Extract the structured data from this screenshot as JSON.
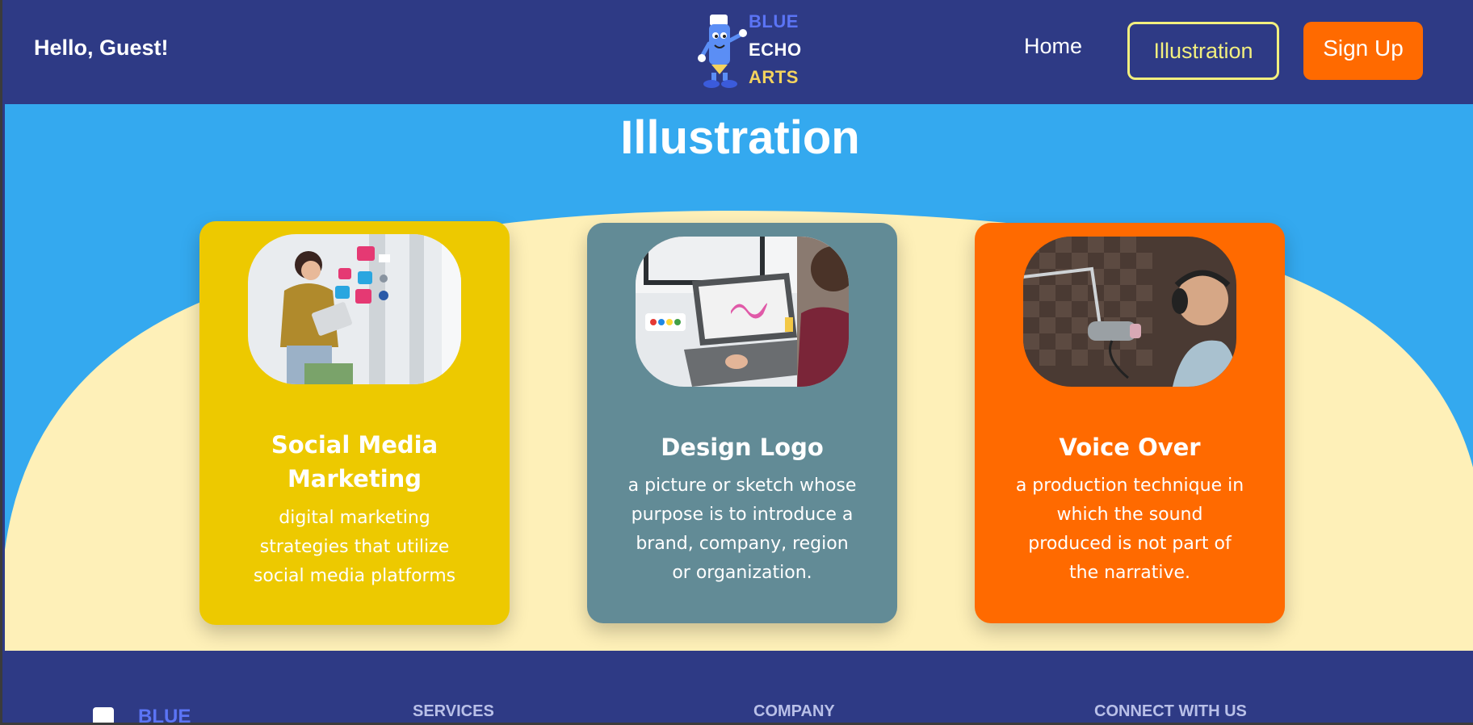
{
  "header": {
    "greeting": "Hello, Guest!",
    "logo_words": [
      "BLUE",
      "ECHO",
      "ARTS"
    ],
    "nav": {
      "home": "Home",
      "illustration": "Illustration",
      "sign_up": "Sign Up"
    }
  },
  "hero": {
    "title": "Illustration"
  },
  "cards": [
    {
      "title": "Social Media Marketing",
      "description": "digital marketing strategies that utilize social media platforms",
      "image_icon": "social-media-photo"
    },
    {
      "title": "Design Logo",
      "description": "a picture or sketch whose purpose is to introduce a brand, company, region or organization.",
      "image_icon": "logo-design-photo"
    },
    {
      "title": "Voice Over",
      "description": "a production technique in which the sound produced is not part of the narrative.",
      "image_icon": "voice-over-photo"
    }
  ],
  "footer": {
    "brand": "BLUE",
    "columns": [
      "SERVICES",
      "COMPANY",
      "CONNECT WITH US"
    ]
  },
  "colors": {
    "navy": "#2e3a85",
    "sky": "#34a9ef",
    "cream": "#fef0b8",
    "yellow": "#edc900",
    "teal": "#628b96",
    "orange": "#ff6a00",
    "active_outline": "#f2ef7e"
  }
}
